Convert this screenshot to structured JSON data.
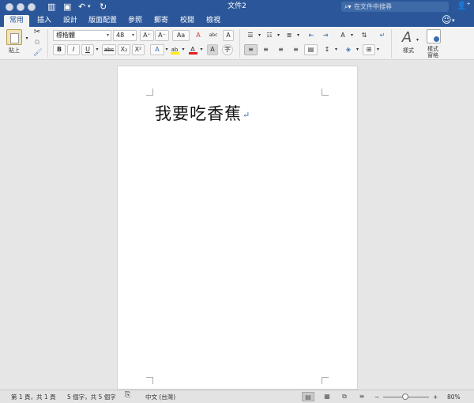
{
  "window": {
    "title": "文件2",
    "search_placeholder": "在文件中搜尋"
  },
  "tabs": [
    "常用",
    "插入",
    "設計",
    "版面配置",
    "參照",
    "郵寄",
    "校閱",
    "檢視"
  ],
  "active_tab": "常用",
  "ribbon": {
    "paste_label": "貼上",
    "font_name": "標楷體",
    "font_size": "48",
    "bold": "B",
    "italic": "I",
    "underline": "U",
    "strikethrough": "abc",
    "subscript": "X₂",
    "superscript": "X²",
    "grow_font": "A⁺",
    "shrink_font": "A⁻",
    "change_case": "Aa",
    "clear_format": "A",
    "phonetic": "abc",
    "char_border": "A",
    "text_effects": "A",
    "highlight": "ab",
    "font_color": "A",
    "char_shading": "A",
    "enclose": "字",
    "styles_label": "樣式",
    "styles_pane_label_1": "樣式",
    "styles_pane_label_2": "窗格"
  },
  "document": {
    "text": "我要吃香蕉",
    "paragraph_mark": "↵"
  },
  "status": {
    "page": "第 1 頁，共 1 頁",
    "words": "5 個字，共 5 個字",
    "language": "中文 (台灣)",
    "zoom": "80%",
    "zoom_minus": "−",
    "zoom_plus": "+"
  },
  "colors": {
    "title_bar": "#2b579a",
    "font_color_bar": "#e02020",
    "highlight_bar": "#ffee00"
  }
}
